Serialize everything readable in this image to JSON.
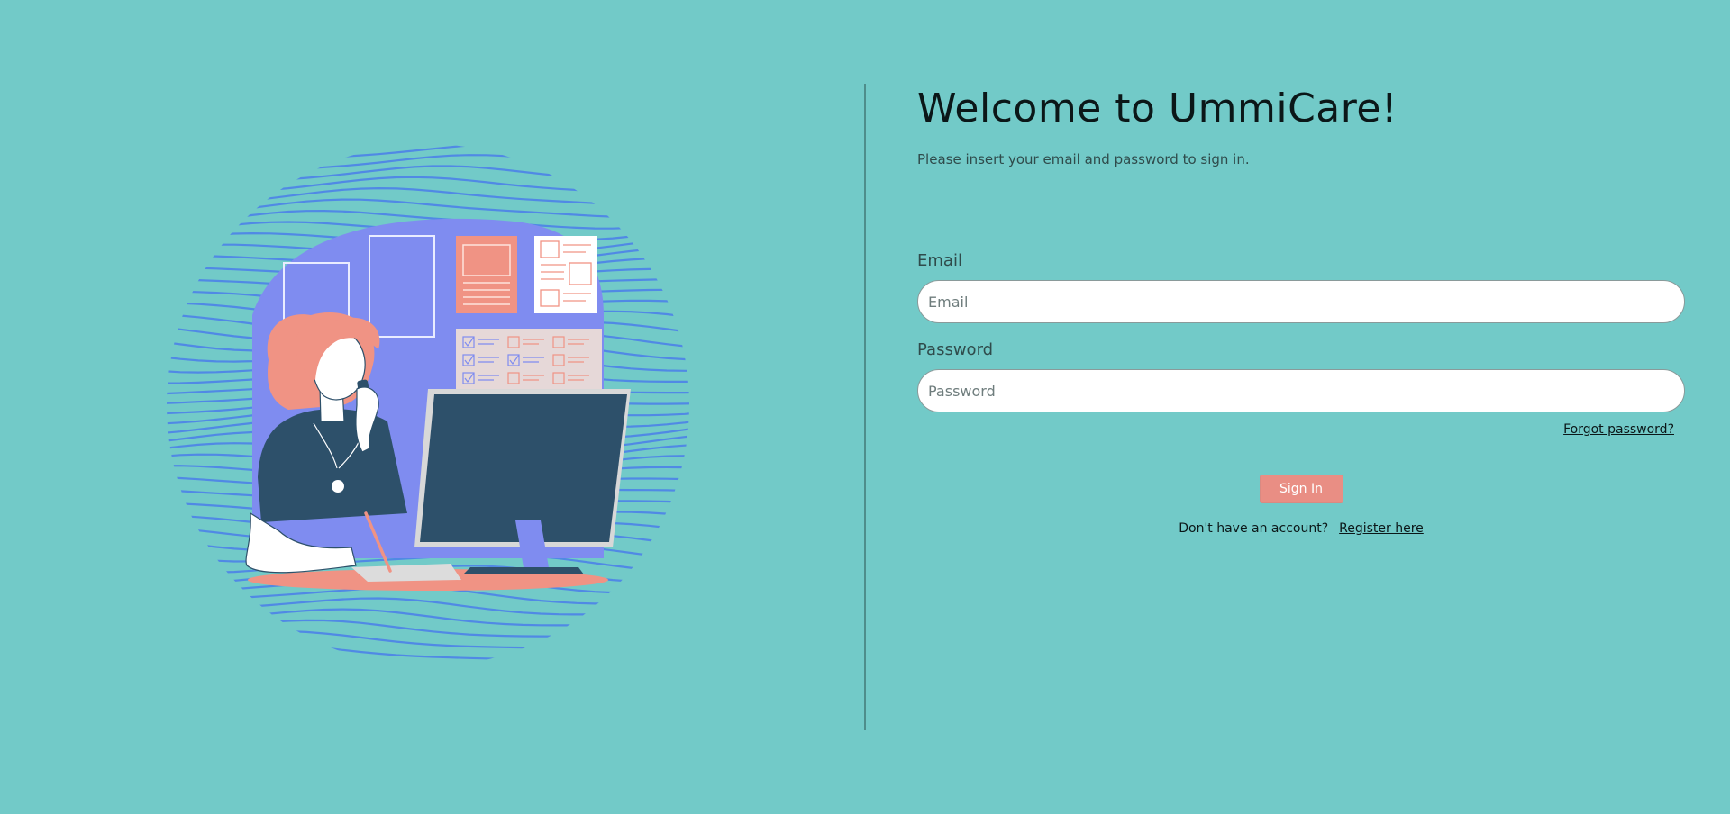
{
  "colors": {
    "background": "#72cac8",
    "accent": "#e98e84",
    "divider": "#4e8d8b",
    "illustration_blue": "#4d82e8",
    "illustration_purple": "#7f8cf0",
    "illustration_salmon": "#f09384",
    "illustration_navy": "#2d506a"
  },
  "welcome": {
    "title": "Welcome to UmmiCare!",
    "subtitle": "Please insert your email and password to sign in."
  },
  "form": {
    "email": {
      "label": "Email",
      "placeholder": "Email",
      "value": ""
    },
    "password": {
      "label": "Password",
      "placeholder": "Password",
      "value": ""
    },
    "forgot_password": "Forgot password?",
    "submit_label": "Sign In"
  },
  "register": {
    "prompt": "Don't have an account?",
    "link": "Register here"
  },
  "illustration": {
    "icon": "woman-at-desk-on-phone-illustration"
  }
}
